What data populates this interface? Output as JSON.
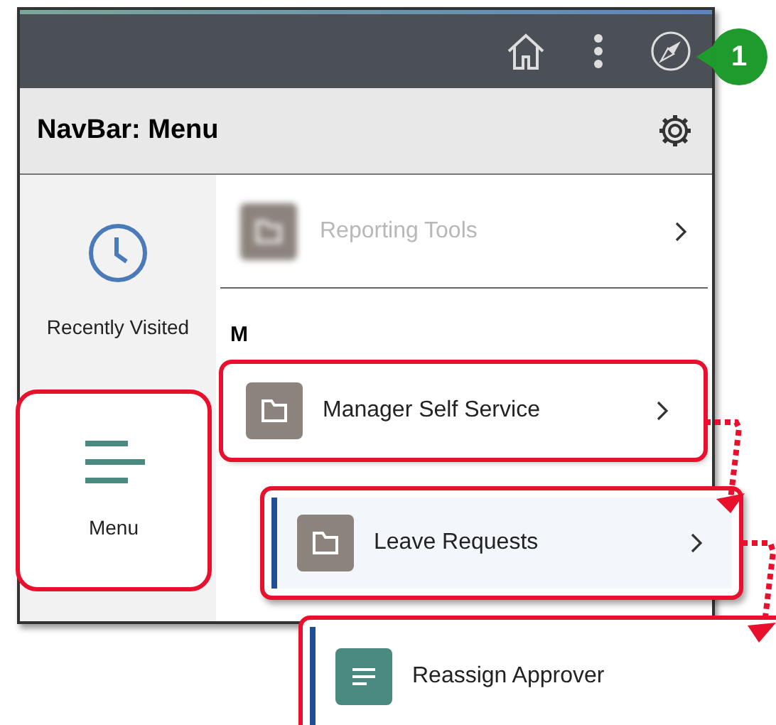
{
  "navbar": {
    "callout": "1"
  },
  "panel": {
    "title": "NavBar: Menu"
  },
  "sidebar": {
    "items": [
      {
        "label": "Recently Visited",
        "kind": "clock",
        "selected": false,
        "highlighted": false
      },
      {
        "label": "Menu",
        "kind": "menu",
        "selected": true,
        "highlighted": true
      }
    ]
  },
  "menu": {
    "items": [
      {
        "label": "Reporting Tools",
        "kind": "folder",
        "blurred": true,
        "highlighted": false
      }
    ],
    "section_heading": "M",
    "section_items": [
      {
        "label": "Manager Self Service",
        "kind": "folder",
        "blurred": false,
        "highlighted": true
      }
    ]
  },
  "drilldown": [
    {
      "label": "Leave Requests",
      "kind": "folder",
      "selected": true,
      "chevron": true
    },
    {
      "label": "Reassign Approver",
      "kind": "component",
      "selected": true,
      "chevron": false
    }
  ]
}
